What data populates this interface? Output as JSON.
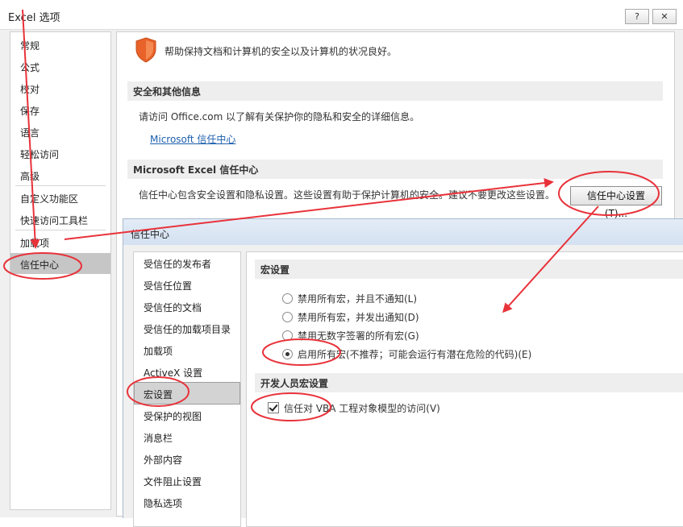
{
  "window": {
    "title": "Excel 选项",
    "help_btn": "?",
    "close_btn": "✕"
  },
  "sidebar": {
    "items": [
      {
        "label": "常规"
      },
      {
        "label": "公式"
      },
      {
        "label": "校对"
      },
      {
        "label": "保存"
      },
      {
        "label": "语言"
      },
      {
        "label": "轻松访问"
      },
      {
        "label": "高级"
      },
      {
        "label": "自定义功能区"
      },
      {
        "label": "快速访问工具栏"
      },
      {
        "label": "加载项"
      },
      {
        "label": "信任中心"
      }
    ],
    "selected": "信任中心"
  },
  "main": {
    "header_text": "帮助保持文档和计算机的安全以及计算机的状况良好。",
    "section1_title": "安全和其他信息",
    "section1_text": "请访问 Office.com  以了解有关保护你的隐私和安全的详细信息。",
    "section1_link": "Microsoft 信任中心",
    "section2_title": "Microsoft Excel 信任中心",
    "section2_text": "信任中心包含安全设置和隐私设置。这些设置有助于保护计算机的安全。建议不要更改这些设置。",
    "trust_center_btn": "信任中心设置(T)..."
  },
  "trust_center": {
    "title": "信任中心",
    "nav_items": [
      {
        "label": "受信任的发布者"
      },
      {
        "label": "受信任位置"
      },
      {
        "label": "受信任的文档"
      },
      {
        "label": "受信任的加载项目录"
      },
      {
        "label": "加载项"
      },
      {
        "label": "ActiveX 设置"
      },
      {
        "label": "宏设置"
      },
      {
        "label": "受保护的视图"
      },
      {
        "label": "消息栏"
      },
      {
        "label": "外部内容"
      },
      {
        "label": "文件阻止设置"
      },
      {
        "label": "隐私选项"
      }
    ],
    "selected": "宏设置",
    "macro_section_title": "宏设置",
    "macro_options": [
      {
        "label": "禁用所有宏，并且不通知(L)",
        "checked": false
      },
      {
        "label": "禁用所有宏，并发出通知(D)",
        "checked": false
      },
      {
        "label": "禁用无数字签署的所有宏(G)",
        "checked": false
      },
      {
        "label": "启用所有宏(不推荐；可能会运行有潜在危险的代码)(E)",
        "checked": true
      }
    ],
    "dev_section_title": "开发人员宏设置",
    "vba_checkbox_label": "信任对 VBA 工程对象模型的访问(V)",
    "vba_checked": true
  },
  "colors": {
    "annotation": "#e8323a",
    "link": "#1e5fae",
    "shield": "#e8622a"
  }
}
